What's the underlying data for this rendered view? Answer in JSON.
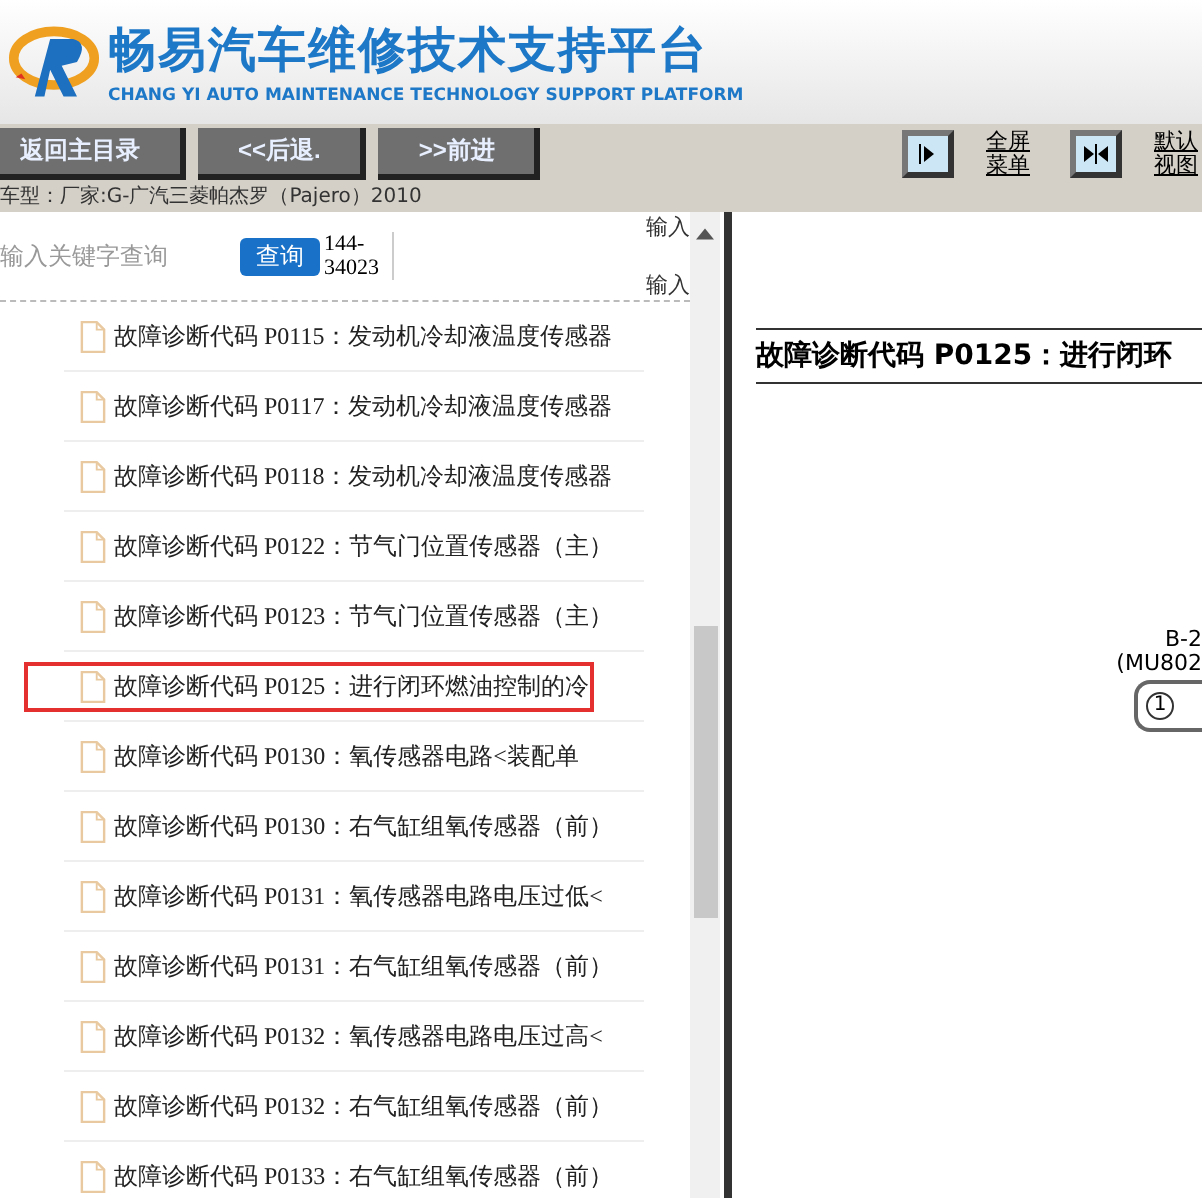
{
  "header": {
    "title": "畅易汽车维修技术支持平台",
    "subtitle": "CHANG YI AUTO MAINTENANCE TECHNOLOGY SUPPORT PLATFORM"
  },
  "toolbar": {
    "buttons": [
      "返回主目录",
      "<<后退.",
      ">>前进"
    ],
    "view_buttons": [
      {
        "kind": "fullscreen",
        "label": [
          "全屏",
          "菜单"
        ]
      },
      {
        "kind": "default",
        "label": [
          "默认",
          "视图"
        ]
      }
    ]
  },
  "vehicle": "车型：厂家:G-广汽三菱帕杰罗（Pajero）2010",
  "search": {
    "placeholder": "输入关键字查询",
    "button": "查询",
    "code": [
      "144-",
      "34023"
    ],
    "side_labels": [
      "输入",
      "输入"
    ]
  },
  "items": [
    {
      "label": "故障诊断代码 P0115：发动机冷却液温度传感器",
      "selected": false
    },
    {
      "label": "故障诊断代码 P0117：发动机冷却液温度传感器",
      "selected": false
    },
    {
      "label": "故障诊断代码 P0118：发动机冷却液温度传感器",
      "selected": false
    },
    {
      "label": "故障诊断代码 P0122：节气门位置传感器（主）",
      "selected": false
    },
    {
      "label": "故障诊断代码 P0123：节气门位置传感器（主）",
      "selected": false
    },
    {
      "label": "故障诊断代码 P0125：进行闭环燃油控制的冷",
      "selected": true
    },
    {
      "label": "故障诊断代码 P0130：氧传感器电路<装配单",
      "selected": false
    },
    {
      "label": "故障诊断代码 P0130：右气缸组氧传感器（前）",
      "selected": false
    },
    {
      "label": "故障诊断代码 P0131：氧传感器电路电压过低<",
      "selected": false
    },
    {
      "label": "故障诊断代码 P0131：右气缸组氧传感器（前）",
      "selected": false
    },
    {
      "label": "故障诊断代码 P0132：氧传感器电路电压过高<",
      "selected": false
    },
    {
      "label": "故障诊断代码 P0132：右气缸组氧传感器（前）",
      "selected": false
    },
    {
      "label": "故障诊断代码 P0133：右气缸组氧传感器（前）",
      "selected": false
    }
  ],
  "document": {
    "heading": "故障诊断代码 P0125：进行闭环",
    "connector": [
      "B-2",
      "(MU802"
    ],
    "pin": "1"
  }
}
